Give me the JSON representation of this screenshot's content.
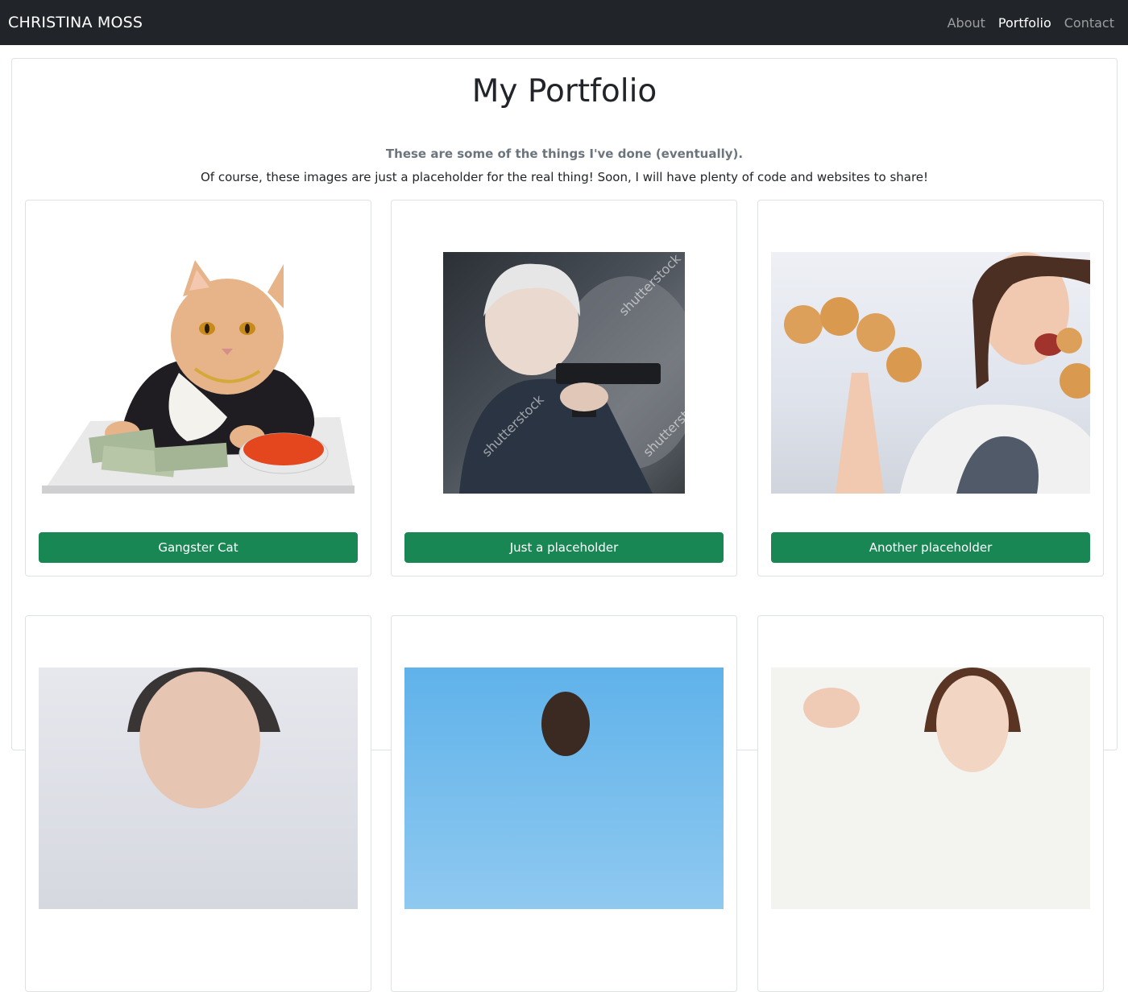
{
  "navbar": {
    "brand": "CHRISTINA MOSS",
    "links": [
      {
        "label": "About",
        "active": false
      },
      {
        "label": "Portfolio",
        "active": true
      },
      {
        "label": "Contact",
        "active": false
      }
    ]
  },
  "main": {
    "title": "My Portfolio",
    "lead": "These are some of the things I've done (eventually).",
    "subtitle": "Of course, these images are just a placeholder for the real thing! Soon, I will have plenty of code and websites to share!"
  },
  "cards": [
    {
      "image": "gangster-cat-image",
      "button_label": "Gangster Cat"
    },
    {
      "image": "grandma-with-gun-image",
      "button_label": "Just a placeholder"
    },
    {
      "image": "woman-with-donuts-image",
      "button_label": "Another placeholder"
    },
    {
      "image": "woman-portrait-image",
      "button_label": ""
    },
    {
      "image": "person-blue-sky-image",
      "button_label": ""
    },
    {
      "image": "woman-stock-photo-image",
      "button_label": ""
    }
  ],
  "image_watermark": "shutterstock",
  "colors": {
    "navbar_bg": "#212529",
    "button_green": "#198754",
    "lead_gray": "#6c757d"
  }
}
